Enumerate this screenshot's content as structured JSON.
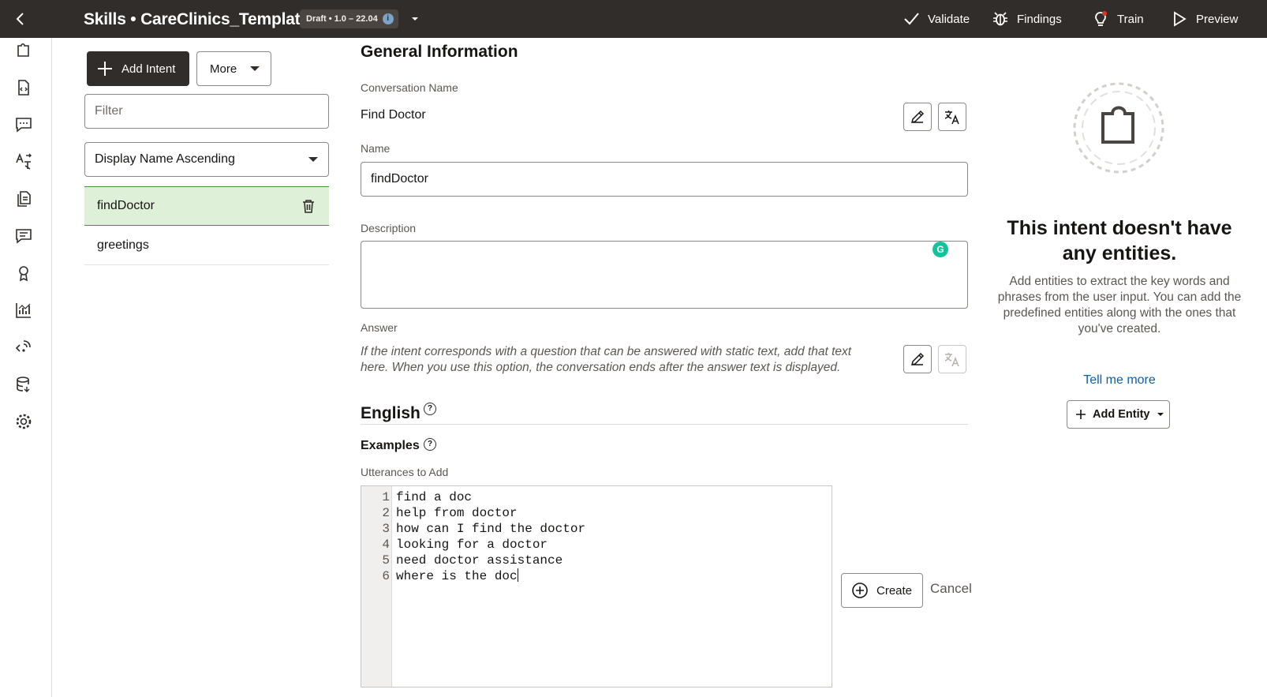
{
  "header": {
    "title": "Skills • CareClinics_Template",
    "version_badge": "Draft • 1.0 – 22.04",
    "actions": {
      "validate": "Validate",
      "findings": "Findings",
      "train": "Train",
      "preview": "Preview"
    }
  },
  "rail": {
    "icons": [
      "intents-icon",
      "entities-icon",
      "flows-icon",
      "resource-bundles-icon",
      "resources-icon",
      "quality-icon",
      "insights-icon",
      "analytics-icon",
      "integrations-icon",
      "data-icon",
      "settings-icon"
    ]
  },
  "intents_panel": {
    "add_intent_label": "Add Intent",
    "more_label": "More",
    "filter_placeholder": "Filter",
    "sort_value": "Display Name Ascending",
    "items": [
      {
        "label": "findDoctor",
        "selected": true
      },
      {
        "label": "greetings",
        "selected": false
      }
    ]
  },
  "general": {
    "section_title": "General Information",
    "conversation_name_label": "Conversation Name",
    "conversation_name": "Find Doctor",
    "name_label": "Name",
    "name_value": "findDoctor",
    "description_label": "Description",
    "description_value": "",
    "answer_label": "Answer",
    "answer_placeholder": "If the intent corresponds with a question that can be answered with static text, add that text here. When you use this option, the conversation ends after the answer text is displayed."
  },
  "language": {
    "title": "English",
    "examples_title": "Examples",
    "utterances_label": "Utterances to Add",
    "utterances": [
      "find a doc",
      "help from doctor",
      "how can I find the doctor",
      "looking for a doctor",
      "need doctor assistance",
      "where is the doc"
    ],
    "create_label": "Create",
    "cancel_label": "Cancel"
  },
  "entities_panel": {
    "empty_title": "This intent doesn't have any entities.",
    "empty_description": "Add entities to extract the key words and phrases from the user input. You can add the predefined entities along with the ones that you've created.",
    "tell_me_more": "Tell me more",
    "add_entity_label": "Add Entity"
  },
  "colors": {
    "topbar": "#312d2a",
    "selected_row": "#dff0d8",
    "link": "#0d5ea8"
  }
}
